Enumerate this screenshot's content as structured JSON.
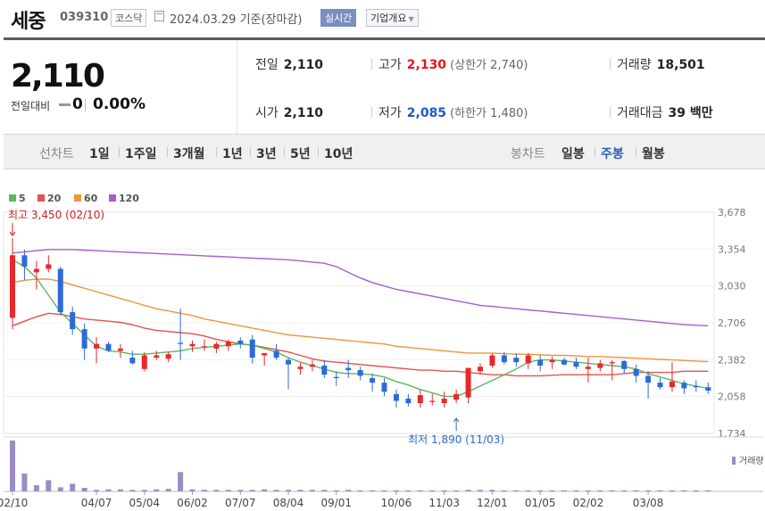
{
  "header": {
    "name": "세중",
    "code": "039310",
    "market": "코스닥",
    "date": "2024.03.29  기준(장마감)",
    "realtime_label": "실시간",
    "company_label": "기업개요"
  },
  "price": {
    "current": "2,110",
    "change_label": "전일대비",
    "change": "0",
    "rate": "0.00%"
  },
  "stats": {
    "prev_label": "전일",
    "prev": "2,110",
    "high_label": "고가",
    "high": "2,130",
    "upper_limit": "(상한가 2,740)",
    "volume_label": "거래량",
    "volume": "18,501",
    "open_label": "시가",
    "open": "2,110",
    "low_label": "저가",
    "low": "2,085",
    "lower_limit": "(하한가 1,480)",
    "amount_label": "거래대금",
    "amount": "39 백만"
  },
  "tabs": {
    "line_label": "선차트",
    "line_periods": [
      "1일",
      "1주일",
      "3개월",
      "1년",
      "3년",
      "5년",
      "10년"
    ],
    "candle_label": "봉차트",
    "candle_periods": [
      "일봉",
      "주봉",
      "월봉"
    ],
    "candle_active": "주봉"
  },
  "legend": [
    {
      "label": "5",
      "color": "#5cb85c"
    },
    {
      "label": "20",
      "color": "#e8504f"
    },
    {
      "label": "60",
      "color": "#f0953a"
    },
    {
      "label": "120",
      "color": "#a55dcf"
    }
  ],
  "chart_data": {
    "type": "candlestick",
    "ylim": [
      1734,
      3678
    ],
    "y_ticks": [
      3678,
      3354,
      3030,
      2706,
      2382,
      2058,
      1734
    ],
    "y_tick_labels": [
      "3,678",
      "3,354",
      "3,030",
      "2,706",
      "2,382",
      "2,058",
      "1,734"
    ],
    "x_tick_labels": [
      {
        "i": 0,
        "label": "02/10"
      },
      {
        "i": 7,
        "label": "04/07"
      },
      {
        "i": 11,
        "label": "05/04"
      },
      {
        "i": 15,
        "label": "06/02"
      },
      {
        "i": 19,
        "label": "07/07"
      },
      {
        "i": 23,
        "label": "08/04"
      },
      {
        "i": 27,
        "label": "09/01"
      },
      {
        "i": 32,
        "label": "10/06"
      },
      {
        "i": 36,
        "label": "11/03"
      },
      {
        "i": 40,
        "label": "12/01"
      },
      {
        "i": 44,
        "label": "01/05"
      },
      {
        "i": 48,
        "label": "02/02"
      },
      {
        "i": 53,
        "label": "03/08"
      }
    ],
    "colors": {
      "up": "#e8282b",
      "down": "#2c6bd6",
      "volume": "#9b8cc4"
    },
    "candles": [
      [
        2750,
        3450,
        2650,
        3300
      ],
      [
        3300,
        3350,
        3080,
        3200
      ],
      [
        3150,
        3250,
        3000,
        3180
      ],
      [
        3180,
        3300,
        3150,
        3220
      ],
      [
        3180,
        3200,
        2780,
        2800
      ],
      [
        2800,
        2850,
        2600,
        2650
      ],
      [
        2650,
        2700,
        2380,
        2480
      ],
      [
        2480,
        2580,
        2350,
        2520
      ],
      [
        2520,
        2540,
        2450,
        2460
      ],
      [
        2460,
        2520,
        2400,
        2480
      ],
      [
        2400,
        2460,
        2340,
        2350
      ],
      [
        2300,
        2450,
        2280,
        2420
      ],
      [
        2400,
        2460,
        2380,
        2420
      ],
      [
        2390,
        2450,
        2360,
        2430
      ],
      [
        2530,
        2830,
        2380,
        2520
      ],
      [
        2500,
        2550,
        2450,
        2520
      ],
      [
        2500,
        2560,
        2460,
        2500
      ],
      [
        2480,
        2540,
        2440,
        2520
      ],
      [
        2500,
        2560,
        2460,
        2540
      ],
      [
        2550,
        2580,
        2480,
        2520
      ],
      [
        2560,
        2600,
        2350,
        2400
      ],
      [
        2420,
        2440,
        2330,
        2440
      ],
      [
        2460,
        2520,
        2380,
        2400
      ],
      [
        2380,
        2400,
        2120,
        2340
      ],
      [
        2300,
        2360,
        2250,
        2320
      ],
      [
        2320,
        2380,
        2280,
        2340
      ],
      [
        2330,
        2380,
        2220,
        2250
      ],
      [
        2230,
        2280,
        2150,
        2220
      ],
      [
        2310,
        2380,
        2220,
        2290
      ],
      [
        2290,
        2320,
        2200,
        2240
      ],
      [
        2220,
        2260,
        2100,
        2180
      ],
      [
        2180,
        2220,
        2060,
        2100
      ],
      [
        2080,
        2120,
        1960,
        2020
      ],
      [
        2040,
        2080,
        1970,
        2000
      ],
      [
        2000,
        2120,
        1960,
        2070
      ],
      [
        2010,
        2080,
        1980,
        2020
      ],
      [
        2000,
        2100,
        1960,
        2040
      ],
      [
        2030,
        2120,
        2000,
        2080
      ],
      [
        2050,
        2300,
        2000,
        2310
      ],
      [
        2280,
        2350,
        2250,
        2320
      ],
      [
        2330,
        2440,
        2310,
        2420
      ],
      [
        2420,
        2450,
        2340,
        2360
      ],
      [
        2400,
        2440,
        2320,
        2360
      ],
      [
        2350,
        2440,
        2300,
        2420
      ],
      [
        2380,
        2420,
        2280,
        2330
      ],
      [
        2360,
        2410,
        2300,
        2380
      ],
      [
        2380,
        2400,
        2330,
        2340
      ],
      [
        2360,
        2400,
        2300,
        2320
      ],
      [
        2300,
        2400,
        2180,
        2320
      ],
      [
        2310,
        2380,
        2280,
        2350
      ],
      [
        2350,
        2380,
        2200,
        2360
      ],
      [
        2370,
        2380,
        2260,
        2300
      ],
      [
        2300,
        2340,
        2180,
        2240
      ],
      [
        2240,
        2280,
        2040,
        2180
      ],
      [
        2180,
        2220,
        2120,
        2140
      ],
      [
        2140,
        2360,
        2100,
        2190
      ],
      [
        2180,
        2200,
        2080,
        2130
      ],
      [
        2150,
        2200,
        2100,
        2140
      ],
      [
        2140,
        2180,
        2080,
        2110
      ]
    ],
    "ma": {
      "5": [
        3260,
        3200,
        3100,
        2950,
        2800,
        2700,
        2600,
        2500,
        2460,
        2450,
        2430,
        2430,
        2440,
        2450,
        2460,
        2480,
        2490,
        2500,
        2510,
        2520,
        2510,
        2480,
        2450,
        2400,
        2360,
        2330,
        2300,
        2270,
        2260,
        2260,
        2250,
        2230,
        2190,
        2160,
        2120,
        2090,
        2060,
        2060,
        2100,
        2150,
        2200,
        2250,
        2300,
        2360,
        2380,
        2380,
        2370,
        2360,
        2350,
        2340,
        2330,
        2320,
        2300,
        2260,
        2230,
        2200,
        2170,
        2150,
        2130
      ],
      "20": [
        2680,
        2720,
        2760,
        2790,
        2780,
        2760,
        2740,
        2730,
        2720,
        2710,
        2690,
        2660,
        2640,
        2630,
        2620,
        2610,
        2590,
        2560,
        2540,
        2520,
        2510,
        2490,
        2470,
        2450,
        2420,
        2390,
        2370,
        2360,
        2350,
        2340,
        2330,
        2320,
        2310,
        2300,
        2290,
        2290,
        2280,
        2280,
        2270,
        2260,
        2250,
        2250,
        2240,
        2240,
        2240,
        2245,
        2250,
        2250,
        2250,
        2250,
        2250,
        2260,
        2270,
        2270,
        2270,
        2270,
        2280,
        2280,
        2280
      ],
      "60": [
        3060,
        3080,
        3090,
        3090,
        3070,
        3040,
        3010,
        2980,
        2950,
        2920,
        2890,
        2860,
        2830,
        2810,
        2790,
        2770,
        2740,
        2720,
        2700,
        2680,
        2660,
        2640,
        2620,
        2600,
        2590,
        2580,
        2570,
        2560,
        2550,
        2540,
        2530,
        2520,
        2500,
        2490,
        2480,
        2470,
        2460,
        2450,
        2440,
        2440,
        2440,
        2435,
        2430,
        2430,
        2425,
        2420,
        2420,
        2415,
        2410,
        2410,
        2405,
        2400,
        2395,
        2390,
        2385,
        2380,
        2375,
        2370,
        2365
      ],
      "120": [
        3320,
        3330,
        3340,
        3350,
        3350,
        3350,
        3345,
        3340,
        3335,
        3330,
        3325,
        3320,
        3315,
        3310,
        3305,
        3300,
        3295,
        3290,
        3285,
        3280,
        3275,
        3270,
        3265,
        3260,
        3250,
        3240,
        3230,
        3200,
        3150,
        3100,
        3060,
        3030,
        3000,
        2980,
        2960,
        2940,
        2920,
        2900,
        2880,
        2860,
        2850,
        2840,
        2830,
        2820,
        2810,
        2800,
        2790,
        2780,
        2770,
        2760,
        2750,
        2740,
        2730,
        2720,
        2710,
        2700,
        2690,
        2685,
        2680
      ]
    },
    "volumes": [
      100,
      35,
      12,
      22,
      8,
      15,
      7,
      3,
      4,
      4,
      3,
      3,
      4,
      5,
      38,
      4,
      3,
      3,
      3,
      3,
      3,
      4,
      3,
      3,
      3,
      3,
      3,
      2,
      3,
      2,
      2,
      2,
      2,
      2,
      2,
      2,
      2,
      2,
      3,
      3,
      3,
      2,
      2,
      2,
      2,
      2,
      2,
      2,
      2,
      2,
      2,
      2,
      2,
      2,
      2,
      2,
      2,
      2,
      2
    ],
    "annotations": {
      "high": {
        "i": 0,
        "price": 3450,
        "text": "최고 3,450 (02/10)"
      },
      "low": {
        "i": 37,
        "price": 1890,
        "text": "최저 1,890 (11/03)"
      }
    },
    "volume_label": "거래량"
  }
}
